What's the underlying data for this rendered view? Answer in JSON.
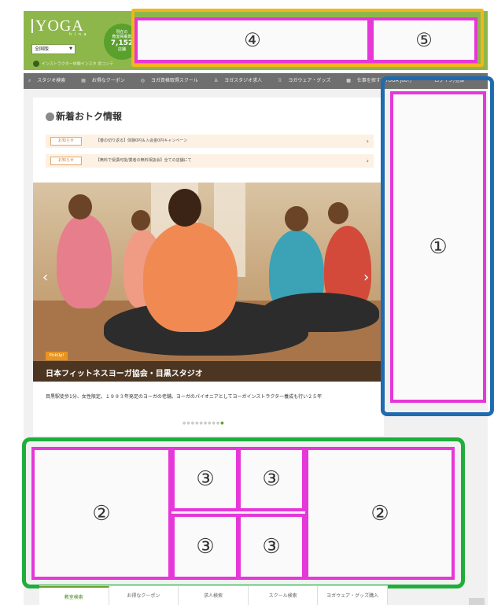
{
  "header": {
    "logo": "YOGA",
    "logo_sub": "h i n a",
    "count_label_1": "現在の",
    "count_label_2": "教室掲載数",
    "count_value": "7,152",
    "count_label_3": "店舗",
    "region_value": "全国版",
    "links": "インストラクター体験インスタ 会コンテ"
  },
  "nav": {
    "items": [
      "スタジオ検索",
      "お得なクーポン",
      "ヨガ資格取得スクール",
      "ヨガスタジオ求人",
      "ヨガウェア・グッズ",
      "仕事を探す「YOGA Job!」",
      "ログイン/登録"
    ]
  },
  "section": {
    "title": "新着おトク情報"
  },
  "news": [
    {
      "tag": "お知らせ",
      "text": "【春の切り返る】体験0円＆入会金0円キャンペーン"
    },
    {
      "tag": "お知らせ",
      "text": "【無料で受講可能/業者の無料相談会】全ての店舗にて"
    }
  ],
  "hero": {
    "badge": "PickUp!",
    "title": "日本フィットネスヨーガ協会・目黒スタジオ",
    "description": "目黒駅徒歩1分、女性限定。１９９３年発足のヨーガの老舗。ヨーガのパイオニアとしてヨーガインストラクター養成も行い２５年",
    "dots": "●●●●●●●●●",
    "active_dot": "●"
  },
  "annotations": {
    "one": "①",
    "two": "②",
    "three": "③",
    "four": "④",
    "five": "⑤"
  },
  "bottom_tabs": [
    "教室検索",
    "お得なクーポン",
    "求人検索",
    "スクール検索",
    "ヨガウェア・グッズ購入"
  ],
  "colors": {
    "header_green": "#8eb74b",
    "orange_box": "#f0b71b",
    "magenta_box": "#e637d8",
    "blue_box": "#1f6bb0",
    "green_box": "#1fae3a"
  }
}
